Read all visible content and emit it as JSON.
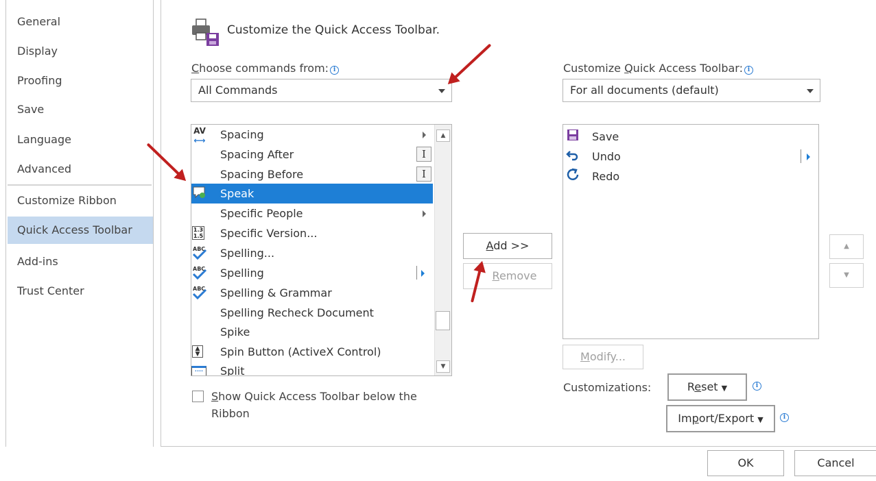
{
  "nav": {
    "items": [
      {
        "label": "General"
      },
      {
        "label": "Display"
      },
      {
        "label": "Proofing"
      },
      {
        "label": "Save"
      },
      {
        "label": "Language"
      },
      {
        "label": "Advanced"
      },
      {
        "label": "Customize Ribbon"
      },
      {
        "label": "Quick Access Toolbar",
        "active": true
      },
      {
        "label": "Add-ins"
      },
      {
        "label": "Trust Center"
      }
    ]
  },
  "header": {
    "title": "Customize the Quick Access Toolbar."
  },
  "left_panel": {
    "choose_label_first": "C",
    "choose_label_rest": "hoose commands from:",
    "choose_value": "All Commands",
    "commands": [
      {
        "label": "Spacing",
        "icon": "spacing-icon",
        "submenu": true
      },
      {
        "label": "Spacing After",
        "icon": "",
        "ibeam": true
      },
      {
        "label": "Spacing Before",
        "icon": "",
        "ibeam": true
      },
      {
        "label": "Speak",
        "icon": "speak-icon",
        "selected": true
      },
      {
        "label": "Specific People",
        "icon": "",
        "submenu": true
      },
      {
        "label": "Specific Version...",
        "icon": "version-icon"
      },
      {
        "label": "Spelling...",
        "icon": "spelling-icon"
      },
      {
        "label": "Spelling",
        "icon": "spelling-icon",
        "splitbutton": true
      },
      {
        "label": "Spelling & Grammar",
        "icon": "spelling-icon"
      },
      {
        "label": "Spelling Recheck Document",
        "icon": ""
      },
      {
        "label": "Spike",
        "icon": ""
      },
      {
        "label": "Spin Button (ActiveX Control)",
        "icon": "spin-button-icon"
      },
      {
        "label": "Split",
        "icon": "split-icon"
      }
    ],
    "checkbox_line1_prefix": "S",
    "checkbox_line1_rest": "how Quick Access Toolbar below the",
    "checkbox_line2": "Ribbon"
  },
  "center": {
    "add_first": "A",
    "add_rest": "dd >>",
    "remove_first": "R",
    "remove_rest": "emove"
  },
  "right_panel": {
    "customize_label_pre": "Customize ",
    "customize_label_u": "Q",
    "customize_label_post": "uick Access Toolbar:",
    "scope_value": "For all documents (default)",
    "commands": [
      {
        "label": "Save",
        "icon": "save-icon"
      },
      {
        "label": "Undo",
        "icon": "undo-icon",
        "splitbutton": true
      },
      {
        "label": "Redo",
        "icon": "redo-icon"
      }
    ],
    "modify_first": "M",
    "modify_rest": "odify...",
    "customizations_label": "Customizations:",
    "reset_pre": "R",
    "reset_u": "e",
    "reset_post": "set",
    "import_pre": "Im",
    "import_u": "p",
    "import_post": "ort/Export"
  },
  "footer": {
    "ok": "OK",
    "cancel": "Cancel"
  },
  "colors": {
    "selection": "#1e7fd6",
    "active_nav": "#c5d9ef",
    "annotation_arrow": "#c0201f",
    "info": "#2b7cd3"
  }
}
